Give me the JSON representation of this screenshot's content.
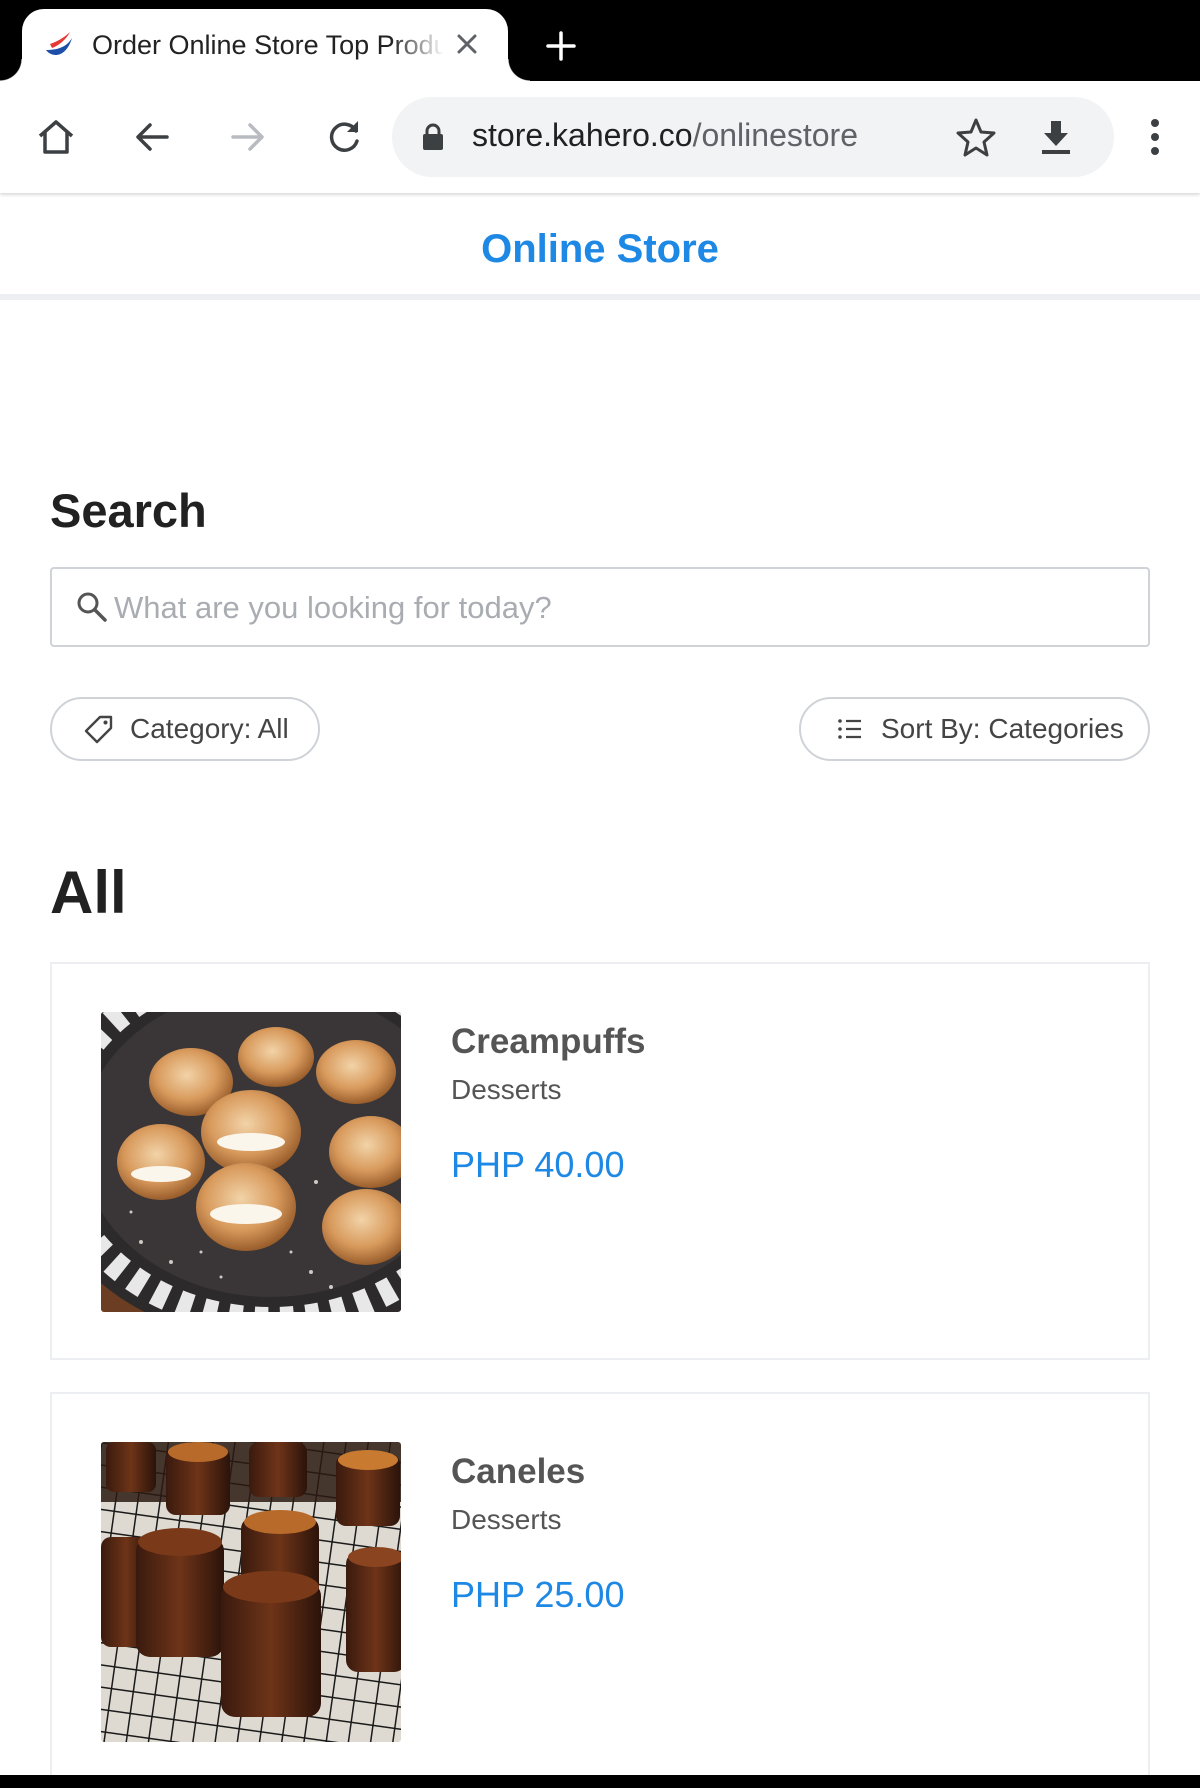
{
  "browser": {
    "tab": {
      "title": "Order Online Store Top Products"
    },
    "address": {
      "domain": "store.kahero.co",
      "path": "/onlinestore"
    }
  },
  "header": {
    "title": "Online Store"
  },
  "search": {
    "heading": "Search",
    "placeholder": "What are you looking for today?",
    "value": ""
  },
  "filters": {
    "category_label": "Category: All",
    "sort_label": "Sort By: Categories"
  },
  "section": {
    "title": "All"
  },
  "products": [
    {
      "name": "Creampuffs",
      "category": "Desserts",
      "price": "PHP 40.00"
    },
    {
      "name": "Caneles",
      "category": "Desserts",
      "price": "PHP 25.00"
    }
  ],
  "colors": {
    "accent": "#1e88e5",
    "border": "#cfd3d7"
  },
  "icons": [
    "favicon-icon",
    "close-icon",
    "plus-icon",
    "home-icon",
    "back-icon",
    "forward-icon",
    "reload-icon",
    "lock-icon",
    "star-icon",
    "download-icon",
    "more-vert-icon",
    "search-icon",
    "tag-icon",
    "list-icon"
  ]
}
